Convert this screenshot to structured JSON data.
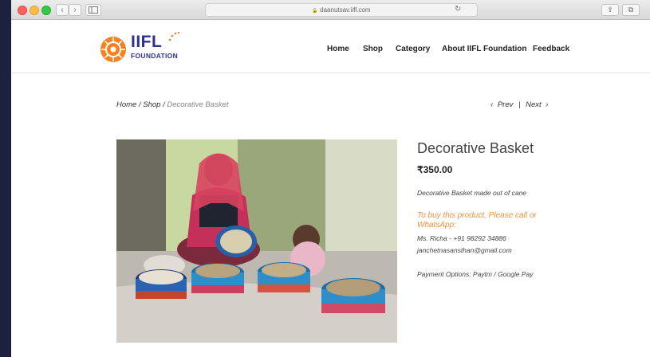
{
  "browser": {
    "url": "daanutsav.iifl.com",
    "lock": "🔒"
  },
  "logo": {
    "title": "IIFL",
    "subtitle": "FOUNDATION"
  },
  "nav": {
    "items": [
      "Home",
      "Shop",
      "Category",
      "About IIFL Foundation",
      "Feedback"
    ]
  },
  "breadcrumb": {
    "home": "Home",
    "sep1": " / ",
    "shop": "Shop",
    "sep2": " / ",
    "current": "Decorative Basket"
  },
  "pager": {
    "prev": "Prev",
    "divider": "|",
    "next": "Next"
  },
  "product": {
    "title": "Decorative Basket",
    "price": "₹350.00",
    "description": "Decorative Basket made out of cane",
    "cta": "To buy this product, Please call or WhatsApp:",
    "contact_name": "Ms. Richa - +91 98292 34886",
    "contact_email": "janchetnasansthan@gmail.com",
    "payment": "Payment Options: Paytm / Google Pay"
  }
}
